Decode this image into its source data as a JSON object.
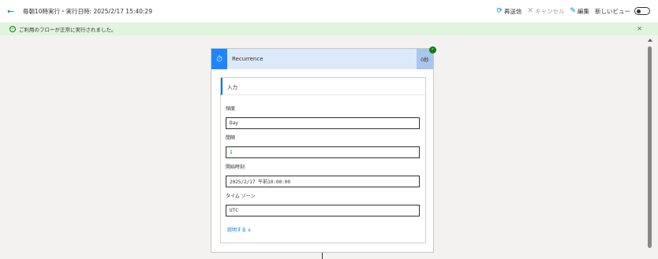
{
  "topbar": {
    "back_icon": "←",
    "run_title": "毎朝10時実行・実行日時: 2025/2/17 15:40:29",
    "resubmit_icon": "⟳",
    "resubmit_label": "再送信",
    "cancel_icon": "✕",
    "cancel_label": "キャンセル",
    "edit_icon": "✎",
    "edit_label": "編集",
    "new_view_label": "新しいビュー"
  },
  "banner": {
    "message": "ご利用のフローが正常に実行されました。",
    "ok_icon": "✓",
    "close_icon": "✕"
  },
  "card": {
    "trigger_icon": "⏱",
    "trigger_name": "Recurrence",
    "duration": "0秒",
    "status_icon": "✓",
    "inputs_header": "入力",
    "fields": [
      {
        "label": "頻度",
        "value": "Day"
      },
      {
        "label": "間隔",
        "value": "1"
      },
      {
        "label": "開始時刻",
        "value": "2025/2/17 午前10:00:00"
      },
      {
        "label": "タイム ゾーン",
        "value": "UTC"
      }
    ],
    "collapse_label": "説明する ∧"
  },
  "colors": {
    "accent": "#0078d4",
    "success": "#107c10",
    "banner_bg": "#dff6dd",
    "trigger_blue": "#1f85ff"
  }
}
